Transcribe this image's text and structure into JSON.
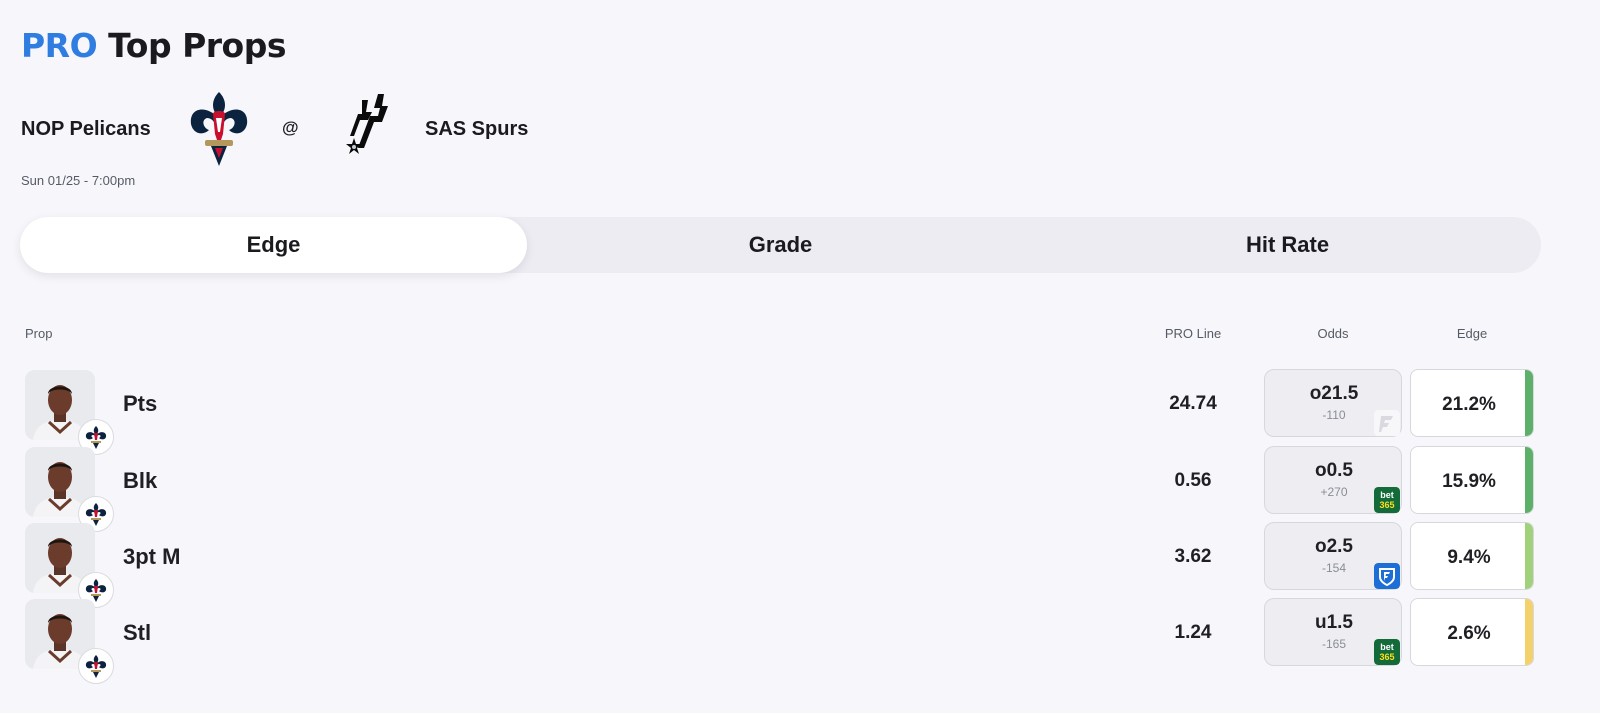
{
  "header": {
    "title_pro": "PRO",
    "title_rest": "Top Props"
  },
  "game": {
    "away_team": "NOP Pelicans",
    "separator": "@",
    "home_team": "SAS Spurs",
    "datetime": "Sun 01/25 - 7:00pm"
  },
  "tabs": [
    {
      "label": "Edge",
      "active": true
    },
    {
      "label": "Grade",
      "active": false
    },
    {
      "label": "Hit Rate",
      "active": false
    }
  ],
  "columns": {
    "prop": "Prop",
    "pro_line": "PRO Line",
    "odds": "Odds",
    "edge": "Edge"
  },
  "rows": [
    {
      "prop": "Pts",
      "pro_line": "24.74",
      "odds_line": "o21.5",
      "odds_price": "-110",
      "book": "fanatics-icon",
      "edge": "21.2%",
      "edge_color": "#5cb06a"
    },
    {
      "prop": "Blk",
      "pro_line": "0.56",
      "odds_line": "o0.5",
      "odds_price": "+270",
      "book": "bet365-icon",
      "edge": "15.9%",
      "edge_color": "#5cb06a"
    },
    {
      "prop": "3pt M",
      "pro_line": "3.62",
      "odds_line": "o2.5",
      "odds_price": "-154",
      "book": "fanduel-icon",
      "edge": "9.4%",
      "edge_color": "#a2d17b"
    },
    {
      "prop": "Stl",
      "pro_line": "1.24",
      "odds_line": "u1.5",
      "odds_price": "-165",
      "book": "bet365-icon",
      "edge": "2.6%",
      "edge_color": "#f3d26b"
    }
  ],
  "colors": {
    "accent": "#2f7de1",
    "bet365": "#136b3a",
    "fanduel": "#1d6fd6"
  },
  "book_text": {
    "bet365": [
      "bet",
      "365"
    ]
  }
}
